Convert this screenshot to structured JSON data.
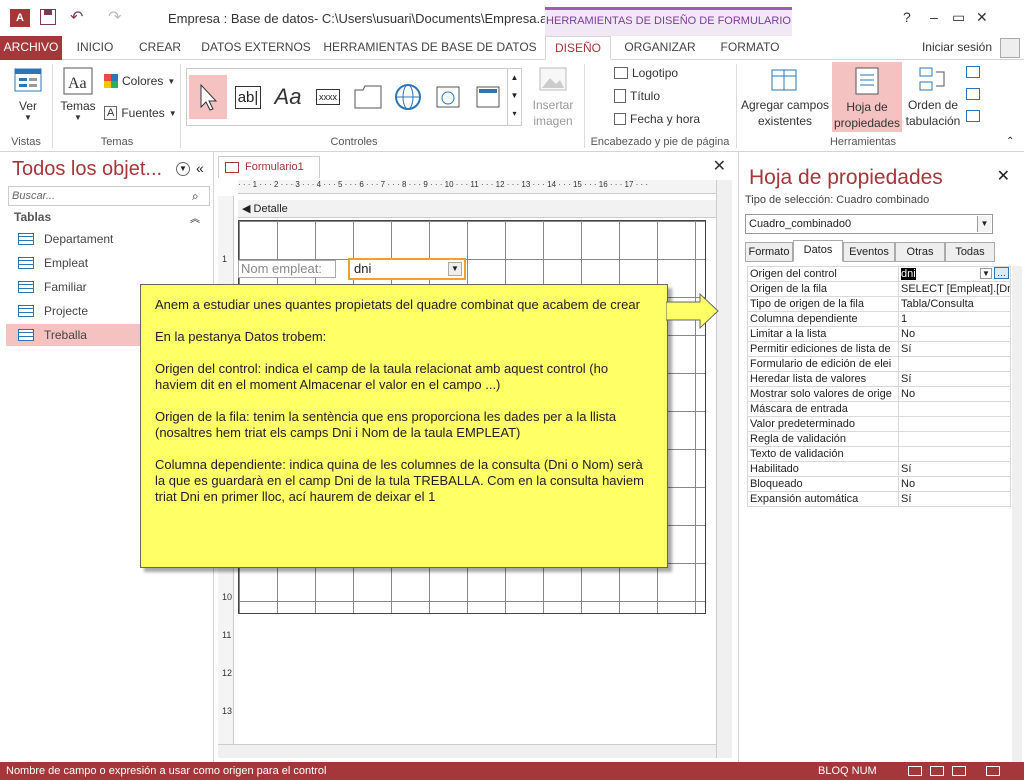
{
  "title_bar": {
    "document_title": "Empresa : Base de datos- C:\\Users\\usuari\\Documents\\Empresa.acc...",
    "context_label": "HERRAMIENTAS DE DISEÑO DE FORMULARIO",
    "controls": {
      "help": "?",
      "minimize": "–",
      "restore": "▭",
      "close": "✕"
    },
    "app_icon": "A",
    "undo": "↶",
    "redo": "↷"
  },
  "ribbon_tabs": {
    "archivo": "ARCHIVO",
    "inicio": "INICIO",
    "crear": "CREAR",
    "datos_externos": "DATOS EXTERNOS",
    "herramientas_bd": "HERRAMIENTAS DE BASE DE DATOS",
    "diseno": "DISEÑO",
    "organizar": "ORGANIZAR",
    "formato": "FORMATO",
    "signin": "Iniciar sesión"
  },
  "ribbon": {
    "vistas": {
      "ver": "Ver",
      "group": "Vistas"
    },
    "temas": {
      "temas": "Temas",
      "colores": "Colores",
      "fuentes": "Fuentes",
      "group": "Temas"
    },
    "controles": {
      "group": "Controles",
      "textbox": "ab|",
      "label": "Aa",
      "button": "xxxx"
    },
    "insertar": {
      "label": "Insertar imagen"
    },
    "encabezado": {
      "logotipo": "Logotipo",
      "titulo": "Título",
      "fecha": "Fecha y hora",
      "group": "Encabezado y pie de página"
    },
    "herramientas": {
      "agregar": "Agregar campos existentes",
      "hoja": "Hoja de propiedades",
      "orden": "Orden de tabulación",
      "group": "Herramientas"
    }
  },
  "nav_pane": {
    "title": "Todos los objet...",
    "search_placeholder": "Buscar...",
    "section": "Tablas",
    "items": [
      {
        "label": "Departament"
      },
      {
        "label": "Empleat"
      },
      {
        "label": "Familiar"
      },
      {
        "label": "Projecte"
      },
      {
        "label": "Treballa"
      }
    ]
  },
  "form": {
    "tab": "Formulario1",
    "close": "✕",
    "section": "Detalle",
    "label_control": "Nom empleat:",
    "combo_value": "dni",
    "ruler_h": "· · · 1 · · · 2 · · · 3 · · · 4 · · · 5 · · · 6 · · · 7 · · · 8 · · · 9 · · · 10 · · · 11 · · · 12 · · · 13 · · · 14 · · · 15 · · · 16 · · · 17 · · ·",
    "ruler_v": [
      "1",
      "10",
      "11",
      "12",
      "13"
    ]
  },
  "callout": {
    "paragraphs": [
      "Anem a estudiar unes quantes propietats del quadre combinat que acabem de crear",
      "En la pestanya Datos trobem:",
      "Origen del control: indica el camp de la taula relacionat amb aquest control (ho haviem dit en el moment Almacenar el valor en el campo ...)",
      "Origen de la fila: tenim la sentència que ens proporciona les dades per a la llista (nosaltres hem triat els camps Dni i Nom de la taula EMPLEAT)",
      "Columna dependiente: indica quina de les columnes de la consulta (Dni o Nom) serà la que es guardarà en el camp Dni de la tula TREBALLA. Com en la consulta haviem triat Dni en primer lloc, ací haurem de deixar el 1"
    ]
  },
  "property_sheet": {
    "title": "Hoja de propiedades",
    "close": "✕",
    "selection_label": "Tipo de selección:  Cuadro combinado",
    "selected_object": "Cuadro_combinado0",
    "tabs": [
      "Formato",
      "Datos",
      "Eventos",
      "Otras",
      "Todas"
    ],
    "active_tab": "Datos",
    "rows": [
      {
        "name": "Origen del control",
        "value": "dni"
      },
      {
        "name": "Origen de la fila",
        "value": "SELECT [Empleat].[Dni"
      },
      {
        "name": "Tipo de origen de la fila",
        "value": "Tabla/Consulta"
      },
      {
        "name": "Columna dependiente",
        "value": "1"
      },
      {
        "name": "Limitar a la lista",
        "value": "No"
      },
      {
        "name": "Permitir ediciones de lista de",
        "value": "Sí"
      },
      {
        "name": "Formulario de edición de elei",
        "value": ""
      },
      {
        "name": "Heredar lista de valores",
        "value": "Sí"
      },
      {
        "name": "Mostrar solo valores de orige",
        "value": "No"
      },
      {
        "name": "Máscara de entrada",
        "value": ""
      },
      {
        "name": "Valor predeterminado",
        "value": ""
      },
      {
        "name": "Regla de validación",
        "value": ""
      },
      {
        "name": "Texto de validación",
        "value": ""
      },
      {
        "name": "Habilitado",
        "value": "Sí"
      },
      {
        "name": "Bloqueado",
        "value": "No"
      },
      {
        "name": "Expansión automática",
        "value": "Sí"
      }
    ]
  },
  "status_bar": {
    "text": "Nombre de campo o expresión a usar como origen para el control",
    "bloq_num": "BLOQ NUM"
  },
  "colors": {
    "accent": "#a4373a",
    "context": "#9f5bb5",
    "callout": "#ffff66"
  }
}
